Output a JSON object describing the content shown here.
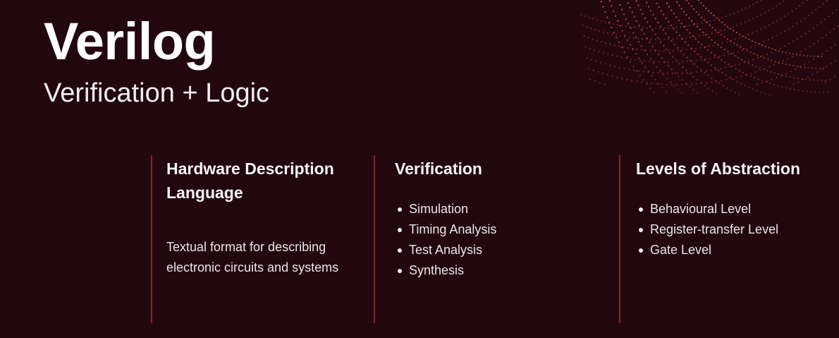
{
  "title": "Verilog",
  "subtitle": "Verification + Logic",
  "colors": {
    "background": "#23070f",
    "accent": "#e0563a",
    "divider": "#7c2a26",
    "text": "#f2f2f2"
  },
  "columns": [
    {
      "heading": "Hardware Description Language",
      "body": "Textual format for describing electronic circuits and systems"
    },
    {
      "heading": "Verification",
      "items": [
        "Simulation",
        "Timing Analysis",
        "Test Analysis",
        "Synthesis"
      ]
    },
    {
      "heading": "Levels of Abstraction",
      "items": [
        "Behavioural Level",
        "Register-transfer Level",
        "Gate Level"
      ]
    }
  ]
}
